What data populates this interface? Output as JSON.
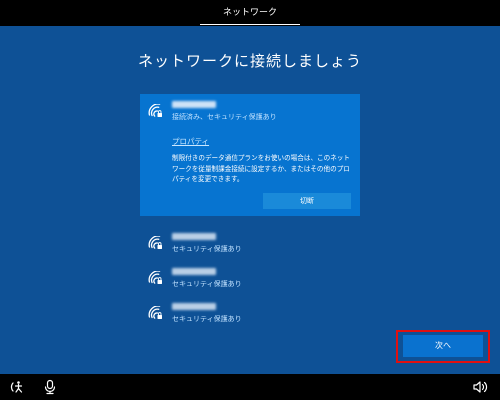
{
  "header": {
    "step_label": "ネットワーク"
  },
  "page": {
    "title": "ネットワークに接続しましょう"
  },
  "networks": [
    {
      "ssid": "xxxxx-xxxxx",
      "status": "接続済み、セキュリティ保護あり",
      "expanded": true,
      "properties_label": "プロパティ",
      "description": "制限付きのデータ通信プランをお使いの場合は、このネットワークを従量制課金接続に設定するか、またはその他のプロパティを変更できます。",
      "disconnect_label": "切断"
    },
    {
      "ssid": "xxxxx-xxxxx",
      "status": "セキュリティ保護あり"
    },
    {
      "ssid": "xxxxx-xxxxx",
      "status": "セキュリティ保護あり"
    },
    {
      "ssid": "xxxxx-xxxxx",
      "status": "セキュリティ保護あり"
    }
  ],
  "footer": {
    "next_label": "次へ"
  },
  "icons": {
    "wifi": "wifi-secured-icon",
    "ease_of_access": "ease-of-access-icon",
    "microphone": "microphone-icon",
    "volume": "volume-icon"
  },
  "colors": {
    "background": "#0e5196",
    "selected_card": "#0774d0",
    "accent_button": "#0a72cf",
    "highlight_outline": "#e01010",
    "link_text": "#c9e7ff"
  }
}
